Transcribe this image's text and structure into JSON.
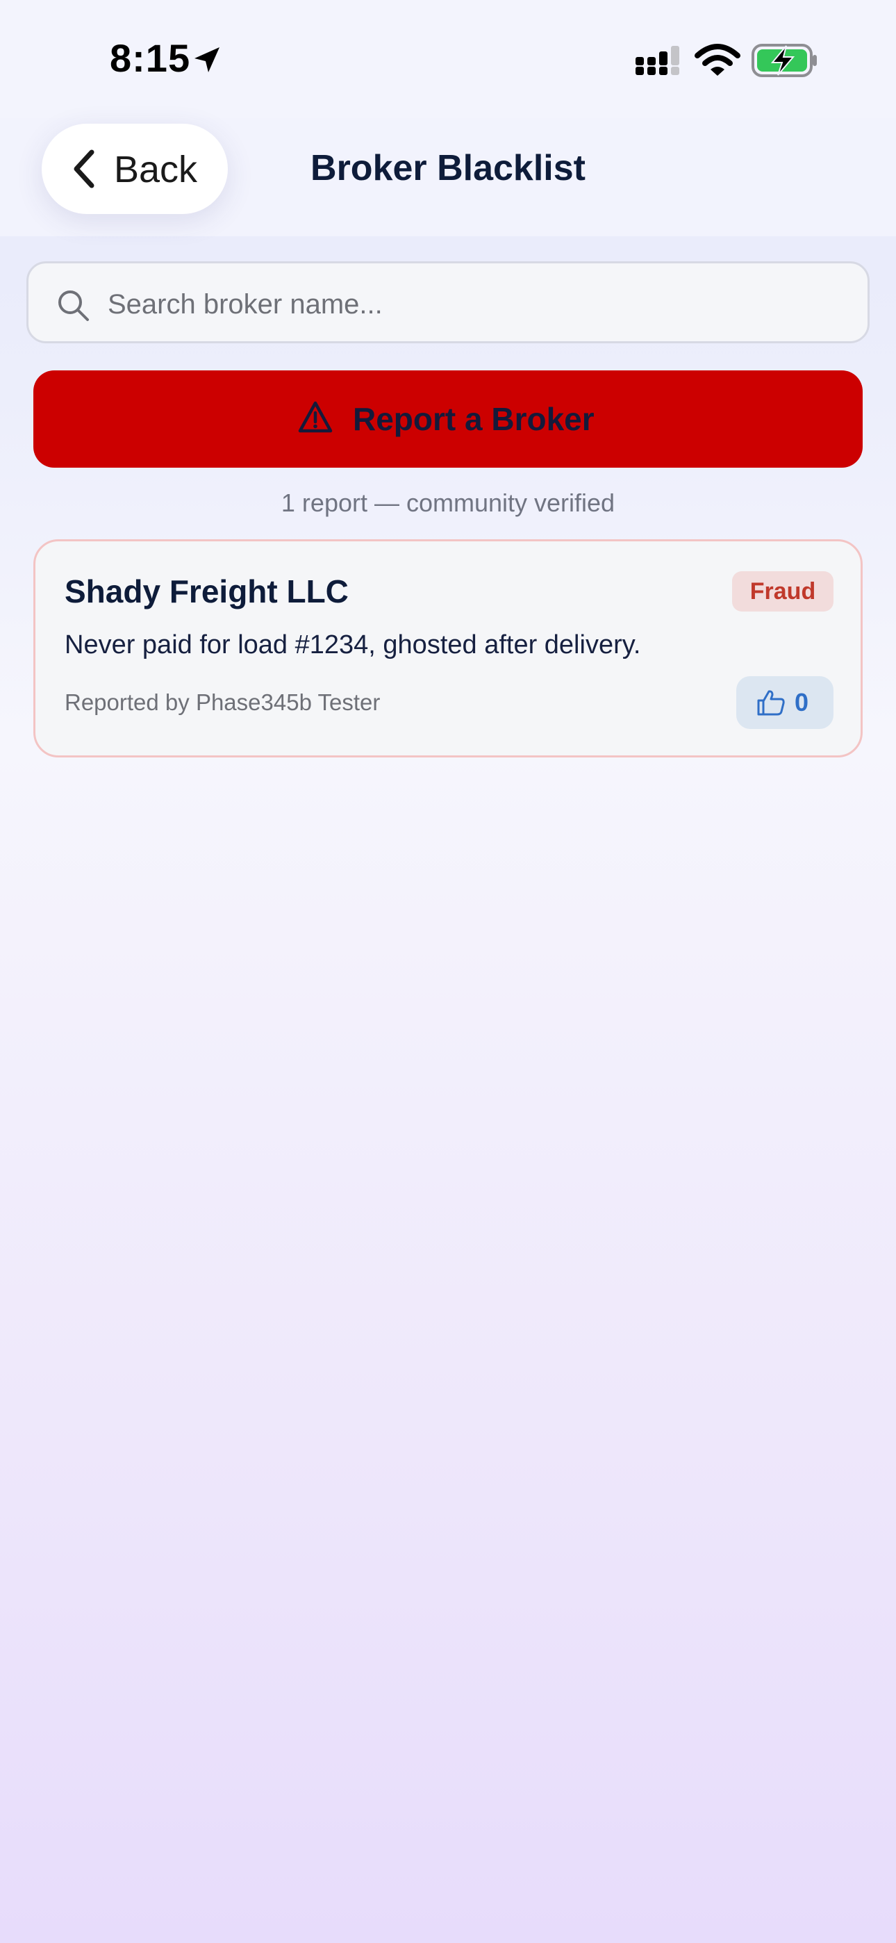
{
  "status_bar": {
    "time": "8:15",
    "icons": [
      "location-arrow-icon",
      "cellular-signal-icon",
      "wifi-icon",
      "battery-charging-icon"
    ]
  },
  "header": {
    "back_label": "Back",
    "title": "Broker Blacklist"
  },
  "search": {
    "placeholder": "Search broker name...",
    "value": ""
  },
  "report_button": {
    "label": "Report a Broker",
    "color": "#cc0000"
  },
  "report_count_text": "1 report — community verified",
  "reports": [
    {
      "broker_name": "Shady Freight LLC",
      "category": "Fraud",
      "description": "Never paid for load #1234, ghosted after delivery.",
      "reporter": "Reported by Phase345b Tester",
      "upvotes": "0"
    }
  ],
  "colors": {
    "accent_red": "#cc0000",
    "title_navy": "#0e1c3a",
    "badge_text": "#c0392b",
    "upvote_blue": "#2f6fc7",
    "battery_green": "#34c759"
  }
}
